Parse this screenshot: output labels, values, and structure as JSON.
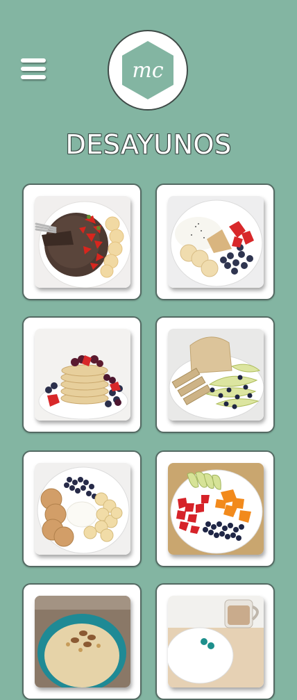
{
  "header": {
    "menu_icon": "hamburger-menu-icon",
    "logo_text": "mc",
    "title": "DESAYUNOS"
  },
  "colors": {
    "background": "#83b5a2",
    "card_border": "#546a63",
    "logo_hexagon": "#83b5a2"
  },
  "recipes": [
    {
      "image": "chocolate-pancake-with-strawberries-and-banana"
    },
    {
      "image": "yogurt-with-pancake-banana-blueberries-strawberries"
    },
    {
      "image": "pancake-stack-with-berries"
    },
    {
      "image": "oat-pancake-stack-with-pear-and-blueberries"
    },
    {
      "image": "cookies-yogurt-banana-blueberries"
    },
    {
      "image": "fruit-plate-apple-strawberry-orange-blueberry"
    },
    {
      "image": "oatmeal-bowl-with-nuts"
    },
    {
      "image": "plate-with-coffee-mug"
    }
  ]
}
